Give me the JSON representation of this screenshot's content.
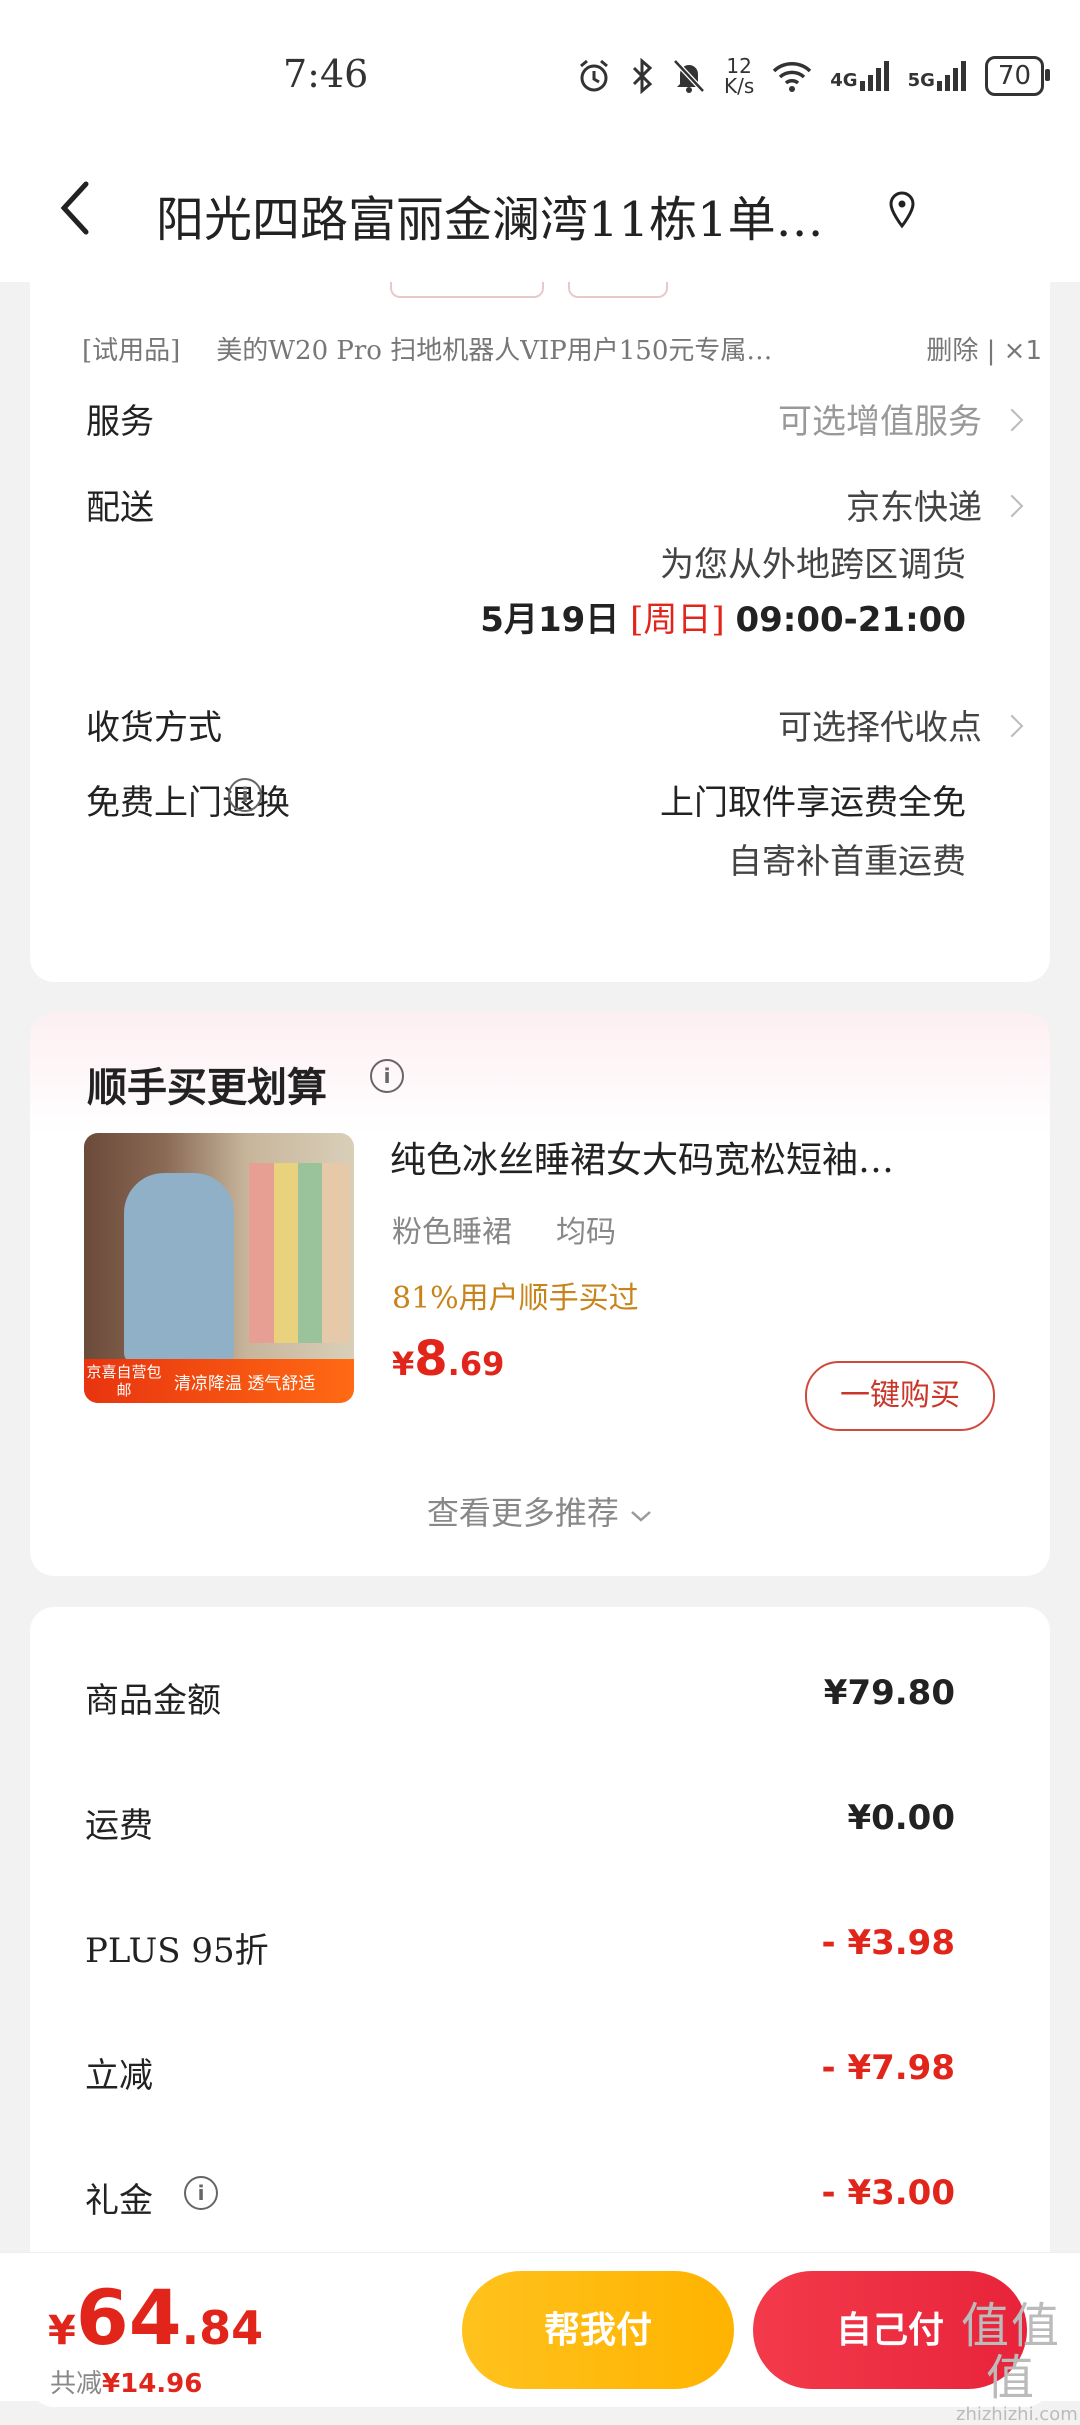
{
  "status_bar": {
    "time": "7:46",
    "net_speed_top": "12",
    "net_speed_bottom": "K/s",
    "signal1": "4G",
    "signal2": "5G",
    "battery": "70"
  },
  "header": {
    "address": "阳光四路富丽金澜湾11栋1单…"
  },
  "order": {
    "gift_tag": "[试用品]",
    "gift_name": "美的W20 Pro 扫地机器人VIP用户150元专属…",
    "gift_actions": "删除 | ×1",
    "service_label": "服务",
    "service_value": "可选增值服务",
    "delivery_label": "配送",
    "delivery_carrier": "京东快递",
    "delivery_note": "为您从外地跨区调货",
    "delivery_date": "5月19日",
    "delivery_day": "[周日]",
    "delivery_time": "09:00-21:00",
    "receive_label": "收货方式",
    "receive_value": "可选择代收点",
    "return_label": "免费上门退换",
    "return_value": "上门取件享运费全免",
    "return_note": "自寄补首重运费"
  },
  "recommend": {
    "title": "顺手买更划算",
    "product": {
      "name": "纯色冰丝睡裙女大码宽松短袖…",
      "spec_color": "粉色睡裙",
      "spec_size": "均码",
      "social_proof": "81%用户顺手买过",
      "price_currency": "¥",
      "price_int": "8",
      "price_dec": ".69",
      "image_tag": "京喜自营包邮",
      "image_slogan": "清凉降温 透气舒适",
      "buy_label": "一键购买"
    },
    "more_label": "查看更多推荐"
  },
  "fees": [
    {
      "label": "商品金额",
      "value": "¥79.80"
    },
    {
      "label": "运费",
      "value": "¥0.00"
    },
    {
      "label": "PLUS 95折",
      "value": "- ¥3.98"
    },
    {
      "label": "立减",
      "value": "- ¥7.98"
    },
    {
      "label": "礼金",
      "value": "- ¥3.00"
    }
  ],
  "bottom": {
    "total_currency": "¥",
    "total_int": "64",
    "total_dec": ".84",
    "saved_label": "共减",
    "saved_amount": "¥14.96",
    "help_pay_label": "帮我付",
    "self_pay_label": "自己付"
  },
  "watermark": {
    "mark": "值值值",
    "site": "zhizhizhi.com"
  },
  "colors": {
    "accent_red": "#e1251b",
    "help_button": "#ffb300",
    "social_gold": "#c8841a"
  }
}
